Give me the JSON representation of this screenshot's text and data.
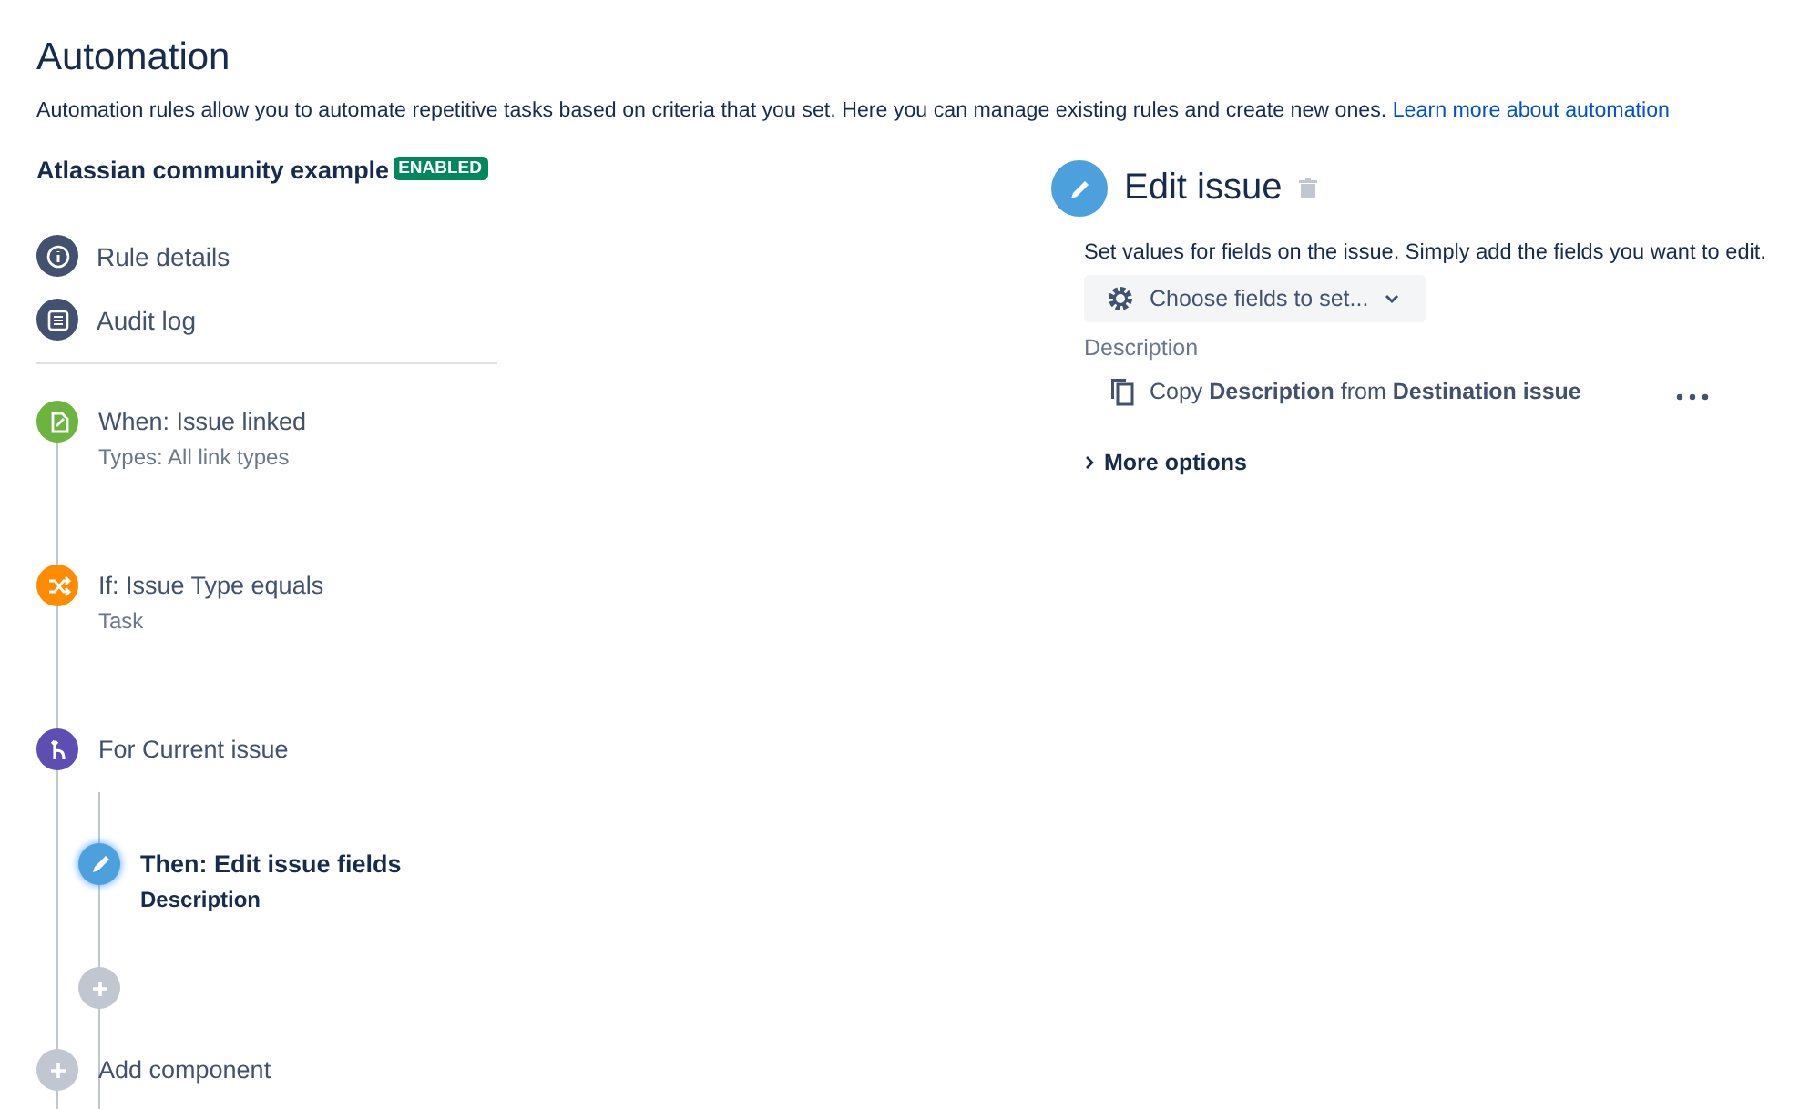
{
  "page": {
    "title": "Automation",
    "intro": "Automation rules allow you to automate repetitive tasks based on criteria that you set. Here you can manage existing rules and create new ones.",
    "intro_link": "Learn more about automation"
  },
  "rule": {
    "name": "Atlassian community example",
    "status": "ENABLED"
  },
  "nav": [
    {
      "label": "Rule details",
      "kind": "info"
    },
    {
      "label": "Audit log",
      "kind": "log"
    }
  ],
  "steps": [
    {
      "kind": "trigger",
      "title": "When: Issue linked",
      "subtitle": "Types: All link types",
      "selected": false
    },
    {
      "kind": "condition",
      "title": "If: Issue Type equals",
      "subtitle": "Task",
      "selected": false
    },
    {
      "kind": "branch",
      "title": "For Current issue",
      "selected": false,
      "children": [
        {
          "kind": "action",
          "title": "Then: Edit issue fields",
          "subtitle": "Description",
          "selected": true
        },
        {
          "kind": "add"
        }
      ]
    },
    {
      "kind": "add",
      "title": "Add component"
    }
  ],
  "editor": {
    "title": "Edit issue",
    "help": "Set values for fields on the issue. Simply add the fields you want to edit.",
    "choose": "Choose fields to set...",
    "field_label": "Description",
    "field_value": "Copy **Description** from **Destination issue**",
    "more": "More options"
  }
}
